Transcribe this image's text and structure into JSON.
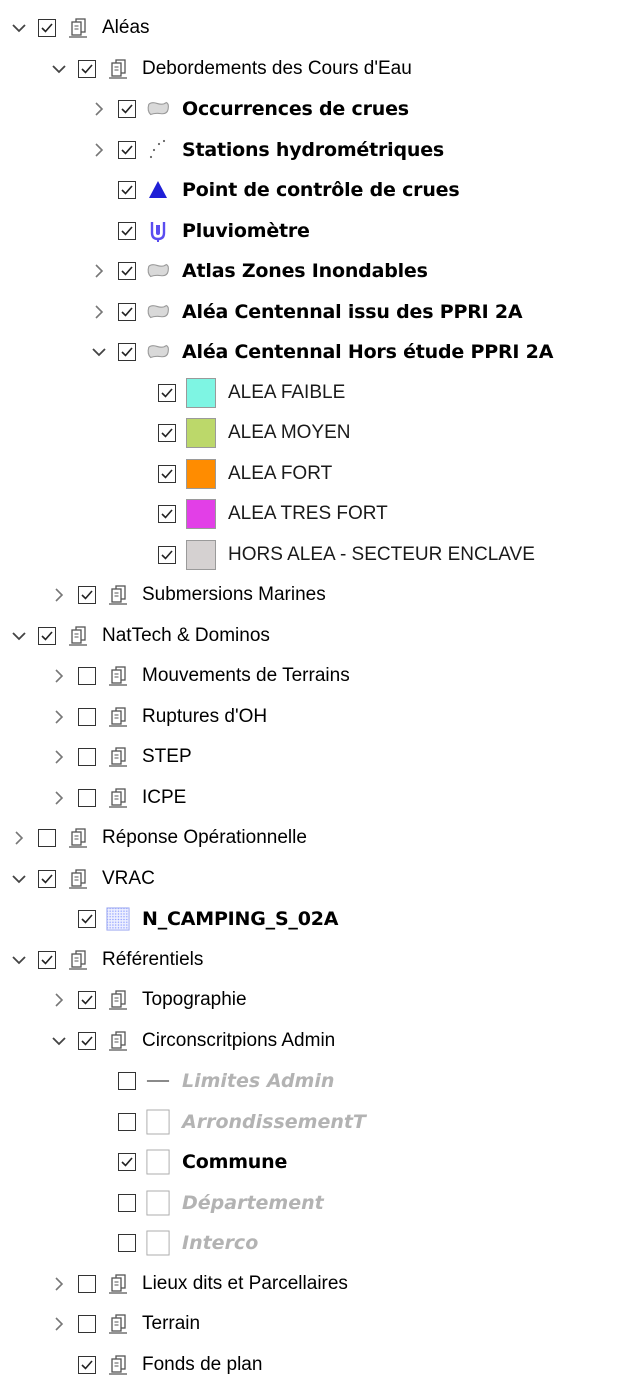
{
  "colors": {
    "alea_faible": "#7ef5e3",
    "alea_moyen": "#bcd86a",
    "alea_fort": "#ff8c00",
    "alea_tres_fort": "#e23fe7",
    "hors_alea": "#d5d1d1",
    "triangle": "#1f1fd6",
    "pluvio": "#5a4df0"
  },
  "tree": [
    {
      "depth": 0,
      "expander": "expanded",
      "checked": true,
      "icon": "group-icon",
      "label": "Aléas",
      "style": "normal"
    },
    {
      "depth": 1,
      "expander": "expanded",
      "checked": true,
      "icon": "group-icon",
      "label": "Debordements des Cours d'Eau",
      "style": "normal"
    },
    {
      "depth": 2,
      "expander": "collapsed",
      "checked": true,
      "icon": "polygon-icon",
      "label": "Occurrences de crues",
      "style": "bold"
    },
    {
      "depth": 2,
      "expander": "collapsed",
      "checked": true,
      "icon": "points-icon",
      "label": "Stations hydrométriques",
      "style": "bold"
    },
    {
      "depth": 2,
      "expander": "none",
      "checked": true,
      "icon": "triangle-icon",
      "label": "Point de contrôle de crues",
      "style": "bold"
    },
    {
      "depth": 2,
      "expander": "none",
      "checked": true,
      "icon": "rain-gauge-icon",
      "label": "Pluviomètre",
      "style": "bold"
    },
    {
      "depth": 2,
      "expander": "collapsed",
      "checked": true,
      "icon": "polygon-icon",
      "label": "Atlas Zones Inondables",
      "style": "bold"
    },
    {
      "depth": 2,
      "expander": "collapsed",
      "checked": true,
      "icon": "polygon-icon",
      "label": "Aléa Centennal issu des PPRI 2A",
      "style": "bold"
    },
    {
      "depth": 2,
      "expander": "expanded",
      "checked": true,
      "icon": "polygon-icon",
      "label": "Aléa Centennal Hors étude PPRI 2A",
      "style": "bold"
    },
    {
      "depth": 3,
      "expander": "none",
      "checked": true,
      "icon": "swatch",
      "swatch": "alea_faible",
      "label": "ALEA FAIBLE",
      "style": "legend"
    },
    {
      "depth": 3,
      "expander": "none",
      "checked": true,
      "icon": "swatch",
      "swatch": "alea_moyen",
      "label": "ALEA MOYEN",
      "style": "legend"
    },
    {
      "depth": 3,
      "expander": "none",
      "checked": true,
      "icon": "swatch",
      "swatch": "alea_fort",
      "label": "ALEA FORT",
      "style": "legend"
    },
    {
      "depth": 3,
      "expander": "none",
      "checked": true,
      "icon": "swatch",
      "swatch": "alea_tres_fort",
      "label": "ALEA TRES FORT",
      "style": "legend"
    },
    {
      "depth": 3,
      "expander": "none",
      "checked": true,
      "icon": "swatch",
      "swatch": "hors_alea",
      "label": "HORS ALEA - SECTEUR ENCLAVE",
      "style": "legend"
    },
    {
      "depth": 1,
      "expander": "collapsed",
      "checked": true,
      "icon": "group-icon",
      "label": "Submersions Marines",
      "style": "normal"
    },
    {
      "depth": 0,
      "expander": "expanded",
      "checked": true,
      "icon": "group-icon",
      "label": "NatTech & Dominos",
      "style": "normal"
    },
    {
      "depth": 1,
      "expander": "collapsed",
      "checked": false,
      "icon": "group-icon",
      "label": "Mouvements de Terrains",
      "style": "normal"
    },
    {
      "depth": 1,
      "expander": "collapsed",
      "checked": false,
      "icon": "group-icon",
      "label": "Ruptures d'OH",
      "style": "normal"
    },
    {
      "depth": 1,
      "expander": "collapsed",
      "checked": false,
      "icon": "group-icon",
      "label": "STEP",
      "style": "normal"
    },
    {
      "depth": 1,
      "expander": "collapsed",
      "checked": false,
      "icon": "group-icon",
      "label": "ICPE",
      "style": "normal"
    },
    {
      "depth": 0,
      "expander": "collapsed",
      "checked": false,
      "icon": "group-icon",
      "label": "Réponse Opérationnelle",
      "style": "normal"
    },
    {
      "depth": 0,
      "expander": "expanded",
      "checked": true,
      "icon": "group-icon",
      "label": "VRAC",
      "style": "normal"
    },
    {
      "depth": 1,
      "expander": "none",
      "checked": true,
      "icon": "hatched-icon",
      "label": "N_CAMPING_S_02A",
      "style": "bold"
    },
    {
      "depth": 0,
      "expander": "expanded",
      "checked": true,
      "icon": "group-icon",
      "label": "Référentiels",
      "style": "normal"
    },
    {
      "depth": 1,
      "expander": "collapsed",
      "checked": true,
      "icon": "group-icon",
      "label": "Topographie",
      "style": "normal"
    },
    {
      "depth": 1,
      "expander": "expanded",
      "checked": true,
      "icon": "group-icon",
      "label": "Circonscritpions Admin",
      "style": "normal"
    },
    {
      "depth": 2,
      "expander": "none",
      "checked": false,
      "icon": "line-icon",
      "label": "Limites Admin",
      "style": "disabled"
    },
    {
      "depth": 2,
      "expander": "none",
      "checked": false,
      "icon": "empty-box-icon",
      "label": "ArrondissementT",
      "style": "disabled"
    },
    {
      "depth": 2,
      "expander": "none",
      "checked": true,
      "icon": "empty-box-icon",
      "label": "Commune",
      "style": "bold"
    },
    {
      "depth": 2,
      "expander": "none",
      "checked": false,
      "icon": "empty-box-icon",
      "label": "Département",
      "style": "disabled"
    },
    {
      "depth": 2,
      "expander": "none",
      "checked": false,
      "icon": "empty-box-icon",
      "label": "Interco",
      "style": "disabled"
    },
    {
      "depth": 1,
      "expander": "collapsed",
      "checked": false,
      "icon": "group-icon",
      "label": "Lieux dits et Parcellaires",
      "style": "normal"
    },
    {
      "depth": 1,
      "expander": "collapsed",
      "checked": false,
      "icon": "group-icon",
      "label": "Terrain",
      "style": "normal"
    },
    {
      "depth": 1,
      "expander": "none",
      "checked": true,
      "icon": "group-icon",
      "label": "Fonds de plan",
      "style": "normal"
    }
  ]
}
